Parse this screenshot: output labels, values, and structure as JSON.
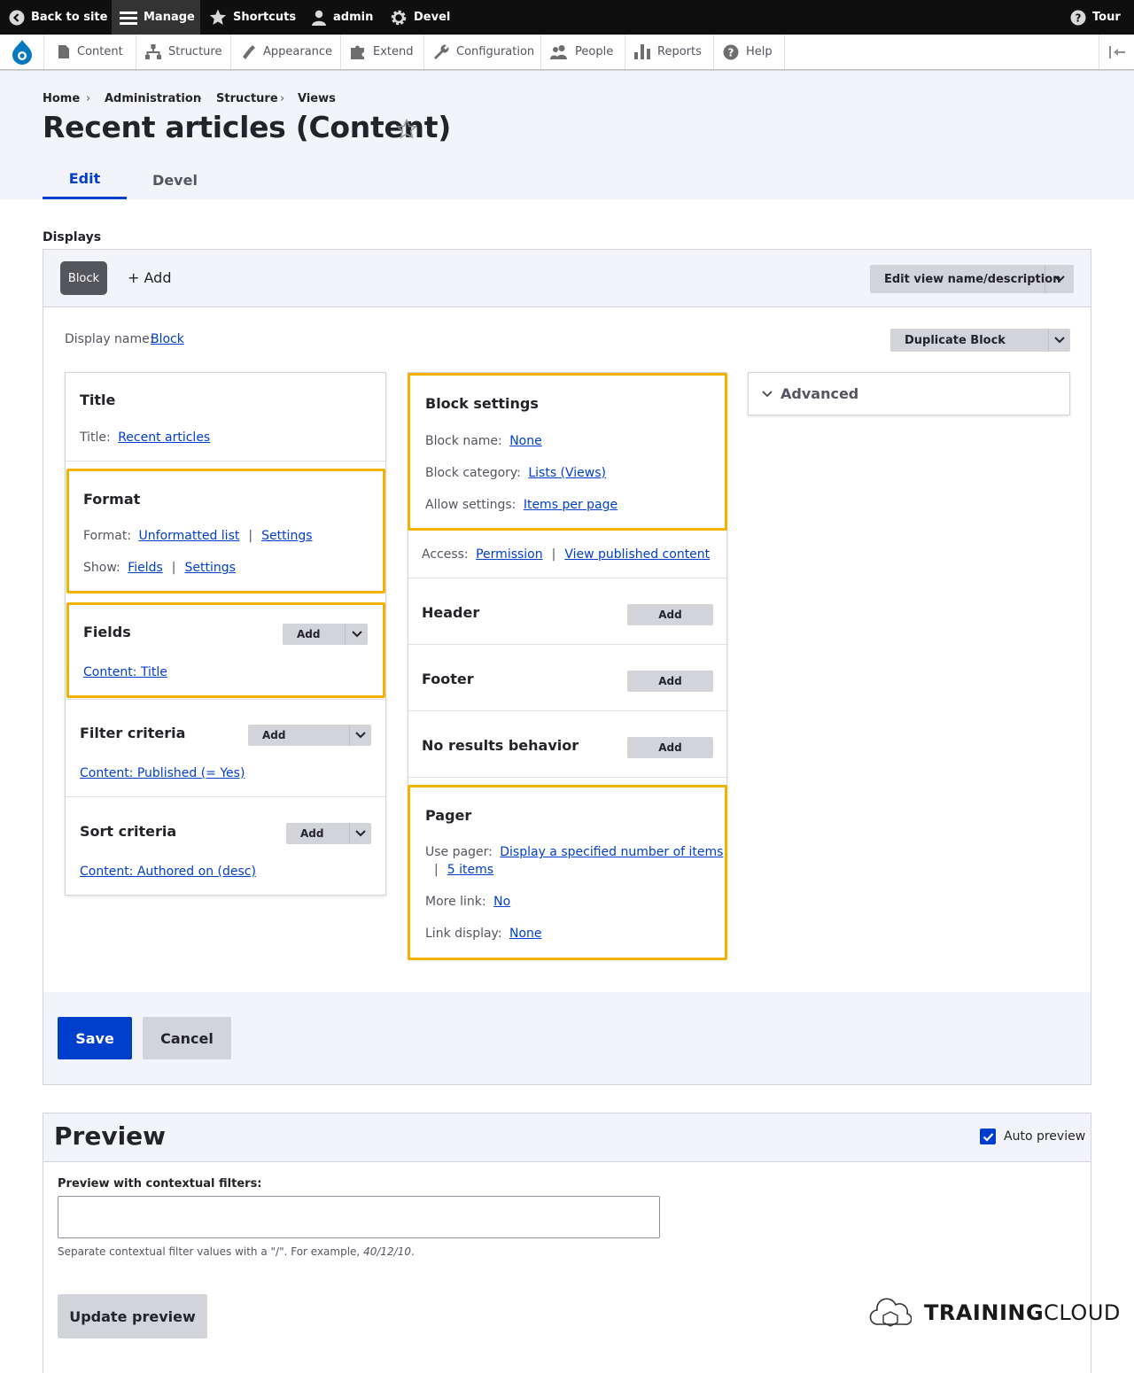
{
  "toolbar": {
    "back": "Back to site",
    "manage": "Manage",
    "shortcuts": "Shortcuts",
    "user": "admin",
    "devel": "Devel",
    "tour": "Tour"
  },
  "tray": {
    "items": [
      "Content",
      "Structure",
      "Appearance",
      "Extend",
      "Configuration",
      "People",
      "Reports",
      "Help"
    ]
  },
  "breadcrumb": [
    "Home",
    "Administration",
    "Structure",
    "Views"
  ],
  "page": {
    "title": "Recent articles (Content)",
    "tabs": [
      "Edit",
      "Devel"
    ]
  },
  "displays": {
    "label": "Displays",
    "active_display": "Block",
    "add": "+ Add",
    "edit_name_btn": "Edit view name/description",
    "display_name_label": "Display name:",
    "display_name_value": "Block",
    "duplicate_btn": "Duplicate Block"
  },
  "col1": {
    "title_section": {
      "heading": "Title",
      "label": "Title:",
      "value": "Recent articles"
    },
    "format_section": {
      "heading": "Format",
      "format_label": "Format:",
      "format_value": "Unformatted list",
      "format_settings": "Settings",
      "show_label": "Show:",
      "show_value": "Fields",
      "show_settings": "Settings"
    },
    "fields_section": {
      "heading": "Fields",
      "add": "Add",
      "item": "Content: Title"
    },
    "filter_section": {
      "heading": "Filter criteria",
      "add": "Add",
      "item": "Content: Published (= Yes)"
    },
    "sort_section": {
      "heading": "Sort criteria",
      "add": "Add",
      "item": "Content: Authored on (desc)"
    }
  },
  "col2": {
    "block_settings": {
      "heading": "Block settings",
      "name_label": "Block name:",
      "name_value": "None",
      "category_label": "Block category:",
      "category_value": "Lists (Views)",
      "allow_label": "Allow settings:",
      "allow_value": "Items per page"
    },
    "access": {
      "label": "Access:",
      "value1": "Permission",
      "value2": "View published content"
    },
    "header": {
      "heading": "Header",
      "add": "Add"
    },
    "footer": {
      "heading": "Footer",
      "add": "Add"
    },
    "no_results": {
      "heading": "No results behavior",
      "add": "Add"
    },
    "pager": {
      "heading": "Pager",
      "use_label": "Use pager:",
      "use_value": "Display a specified number of items",
      "items_value": "5 items",
      "more_label": "More link:",
      "more_value": "No",
      "link_label": "Link display:",
      "link_value": "None"
    }
  },
  "col3": {
    "advanced": "Advanced"
  },
  "actions": {
    "save": "Save",
    "cancel": "Cancel"
  },
  "preview": {
    "heading": "Preview",
    "auto_preview": "Auto preview",
    "auto_checked": true,
    "contextual_label": "Preview with contextual filters:",
    "contextual_value": "",
    "help_prefix": "Separate contextual filter values with a \"/\". For example, ",
    "help_example": "40/12/10",
    "help_suffix": ".",
    "update_btn": "Update preview"
  },
  "watermark": {
    "bold": "TRAINING",
    "light": "CLOUD"
  },
  "colors": {
    "accent": "#003ecc",
    "highlight": "#f0b400",
    "toolbar": "#0f0f0f"
  }
}
